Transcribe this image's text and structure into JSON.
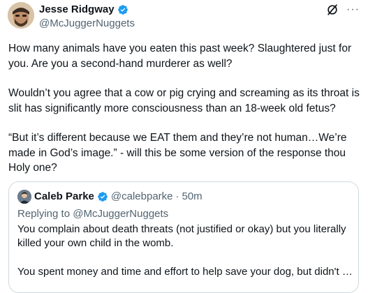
{
  "author": {
    "name": "Jesse Ridgway",
    "handle": "@McJuggerNuggets",
    "verified": true,
    "avatar_icon": "avatar-photo"
  },
  "top_actions": {
    "grok_icon": "grok-icon",
    "more_icon": "more-dots-icon",
    "more_label": "···"
  },
  "tweet": {
    "paragraphs": [
      "How many animals have you eaten this past week? Slaughtered just for you. Are you a second-hand murderer as well?",
      "Wouldn’t you agree that a cow or pig crying and screaming as its throat is slit has significantly more consciousness than an 18-week old fetus?",
      "“But it’s different because we EAT them and they’re not human…We’re made in God’s image.” - will this be some version of the response thou Holy one?"
    ]
  },
  "quote": {
    "name": "Caleb Parke",
    "handle": "@calebparke",
    "separator": "·",
    "time": "50m",
    "verified": true,
    "reply_prefix": "Replying to",
    "reply_handle": "@McJuggerNuggets",
    "paragraphs": [
      "You complain about death threats (not justified or okay) but you literally killed your own child in the womb.",
      "You spent money and time and effort to help save your dog, but didn't give th..."
    ]
  },
  "colors": {
    "verified_blue": "#1d9bf0",
    "secondary_text": "#536471",
    "border": "#cfd9de",
    "text": "#0f1419"
  }
}
